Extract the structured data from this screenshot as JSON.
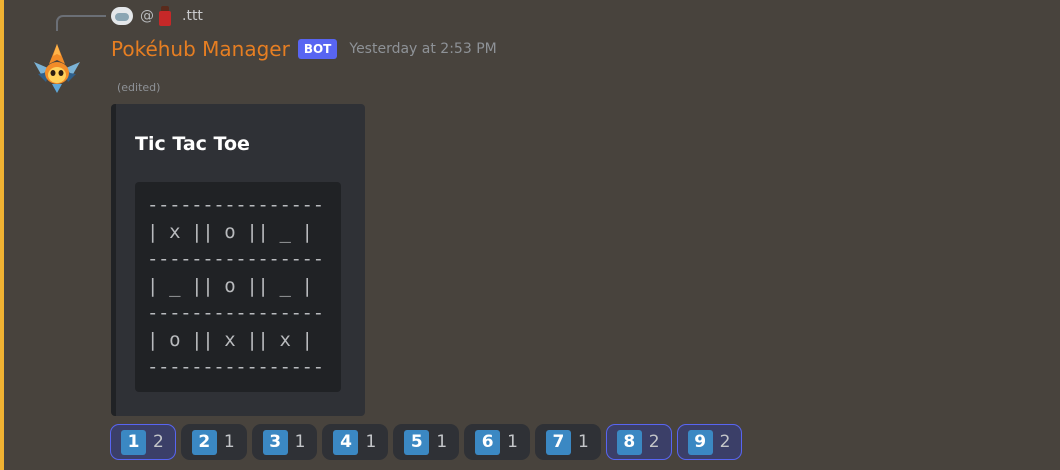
{
  "reply": {
    "at": "@",
    "text": ".ttt"
  },
  "message": {
    "username": "Pokéhub Manager",
    "bot_tag": "BOT",
    "timestamp": "Yesterday at 2:53 PM",
    "edited": "(edited)",
    "username_color": "#e67e22",
    "accent_color": "#f0b232"
  },
  "embed": {
    "title": "Tic Tac Toe",
    "lines": [
      "----------------",
      "| x || o || _ |",
      "----------------",
      "| _ || o || _ |",
      "----------------",
      "| o || x || x |",
      "----------------"
    ]
  },
  "reactions": [
    {
      "emoji": "1",
      "count": "2",
      "me": true
    },
    {
      "emoji": "2",
      "count": "1",
      "me": false
    },
    {
      "emoji": "3",
      "count": "1",
      "me": false
    },
    {
      "emoji": "4",
      "count": "1",
      "me": false
    },
    {
      "emoji": "5",
      "count": "1",
      "me": false
    },
    {
      "emoji": "6",
      "count": "1",
      "me": false
    },
    {
      "emoji": "7",
      "count": "1",
      "me": false
    },
    {
      "emoji": "8",
      "count": "2",
      "me": true
    },
    {
      "emoji": "9",
      "count": "2",
      "me": true
    }
  ]
}
